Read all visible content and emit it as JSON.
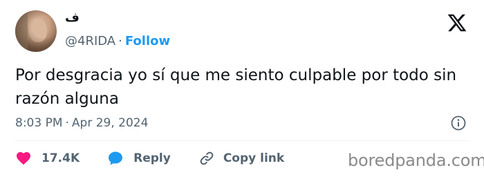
{
  "author": {
    "display_name": "ف",
    "handle": "@4RIDA",
    "separator": "·",
    "follow_label": "Follow"
  },
  "tweet": {
    "text": "Por desgracia yo sí que me siento culpable por todo sin razón alguna",
    "time": "8:03 PM",
    "separator": "·",
    "date": "Apr 29, 2024"
  },
  "actions": {
    "like_count": "17.4K",
    "reply_label": "Reply",
    "copy_link_label": "Copy link"
  },
  "watermark": "boredpanda.com",
  "colors": {
    "accent": "#1d9bf0",
    "like": "#f91880",
    "muted": "#536471",
    "text": "#0f1419"
  },
  "icons": {
    "logo": "x-logo-icon",
    "info": "info-icon",
    "like": "heart-icon",
    "reply": "speech-bubble-icon",
    "copy": "link-icon"
  }
}
